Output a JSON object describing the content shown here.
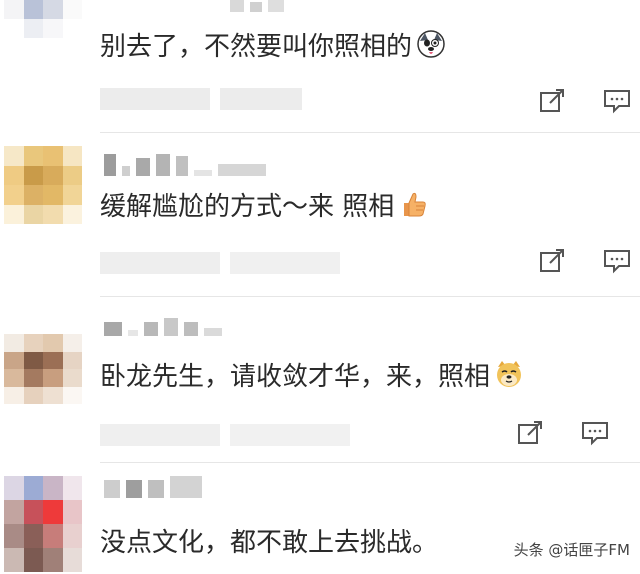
{
  "comments": [
    {
      "text": "别去了，不然要叫你照相的",
      "emoji": "husky-face-icon"
    },
    {
      "text": "缓解尴尬的方式～来 照相",
      "emoji": "thumbs-up-icon"
    },
    {
      "text": "卧龙先生，请收敛才华，来，照相",
      "emoji": "doge-face-icon"
    },
    {
      "text": "没点文化，都不敢上去挑战。",
      "emoji": ""
    }
  ],
  "watermark": "头条 @话匣子FM",
  "colors": {
    "divider": "#e6e6e6",
    "icon_stroke": "#555555",
    "text": "#2a2a2a"
  }
}
